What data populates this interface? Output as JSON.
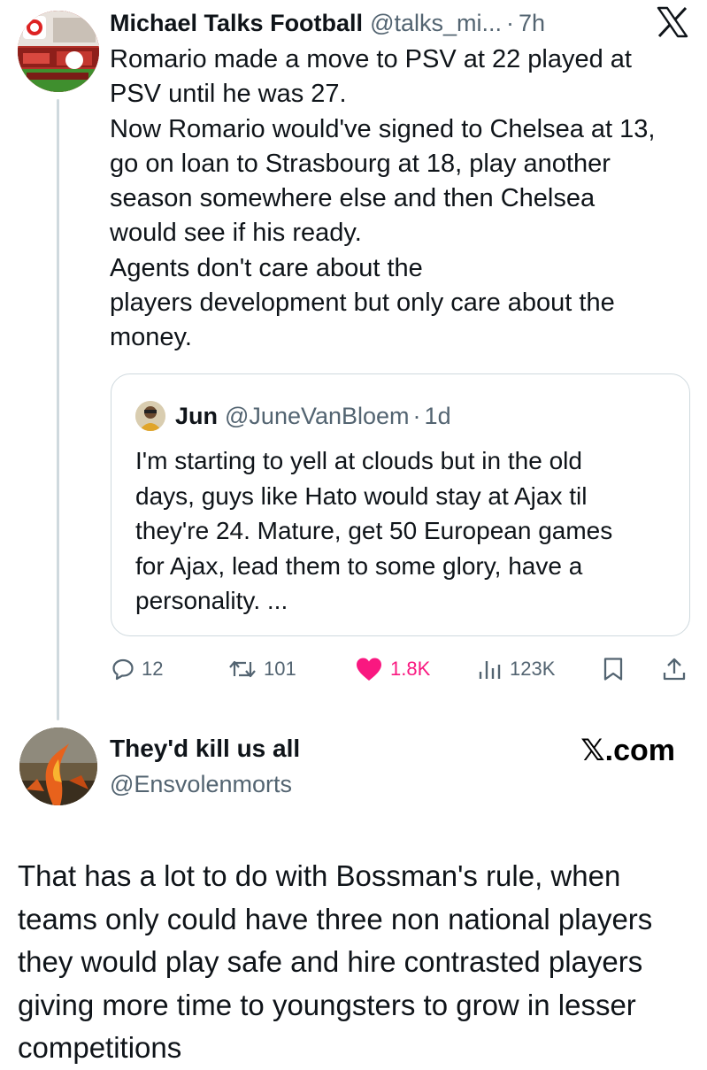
{
  "tweet": {
    "author_name": "Michael Talks Football",
    "author_handle": "@talks_mi...",
    "separator": "·",
    "time": "7h",
    "text_lines": [
      "Romario made a move to PSV at 22 played at",
      "PSV until he was 27.",
      "Now Romario would've signed to Chelsea at 13,",
      "go on loan to Strasbourg at 18, play another",
      "season somewhere else and then Chelsea",
      "would see if his ready.",
      "Agents don't care about the",
      "players development but  only care about the",
      "money."
    ],
    "quote": {
      "author_name": "Jun",
      "author_handle": "@JuneVanBloem",
      "separator": "·",
      "time": "1d",
      "text_lines": [
        "I'm starting to yell at clouds but in the old",
        "days, guys like Hato would stay at Ajax til",
        "they're 24. Mature, get 50 European games",
        "for Ajax, lead them to some glory, have a",
        "personality. ..."
      ]
    },
    "actions": {
      "replies": "12",
      "reposts": "101",
      "likes": "1.8K",
      "views": "123K"
    }
  },
  "reply": {
    "author_name": "They'd kill us all",
    "author_handle": "@Ensvolenmorts",
    "watermark": "𝕏.com",
    "text_lines": [
      "That has a lot to do with Bossman's rule, when",
      "teams only could have three non national players",
      "they would play safe and hire contrasted players",
      "giving more time to youngsters to grow in lesser",
      "competitions"
    ]
  },
  "colors": {
    "text": "#0f1419",
    "secondary": "#536471",
    "like": "#f91880",
    "border": "#cfd9de"
  },
  "icons": [
    "x-logo-icon",
    "reply-icon",
    "repost-icon",
    "heart-icon",
    "views-icon",
    "bookmark-icon",
    "share-icon"
  ]
}
